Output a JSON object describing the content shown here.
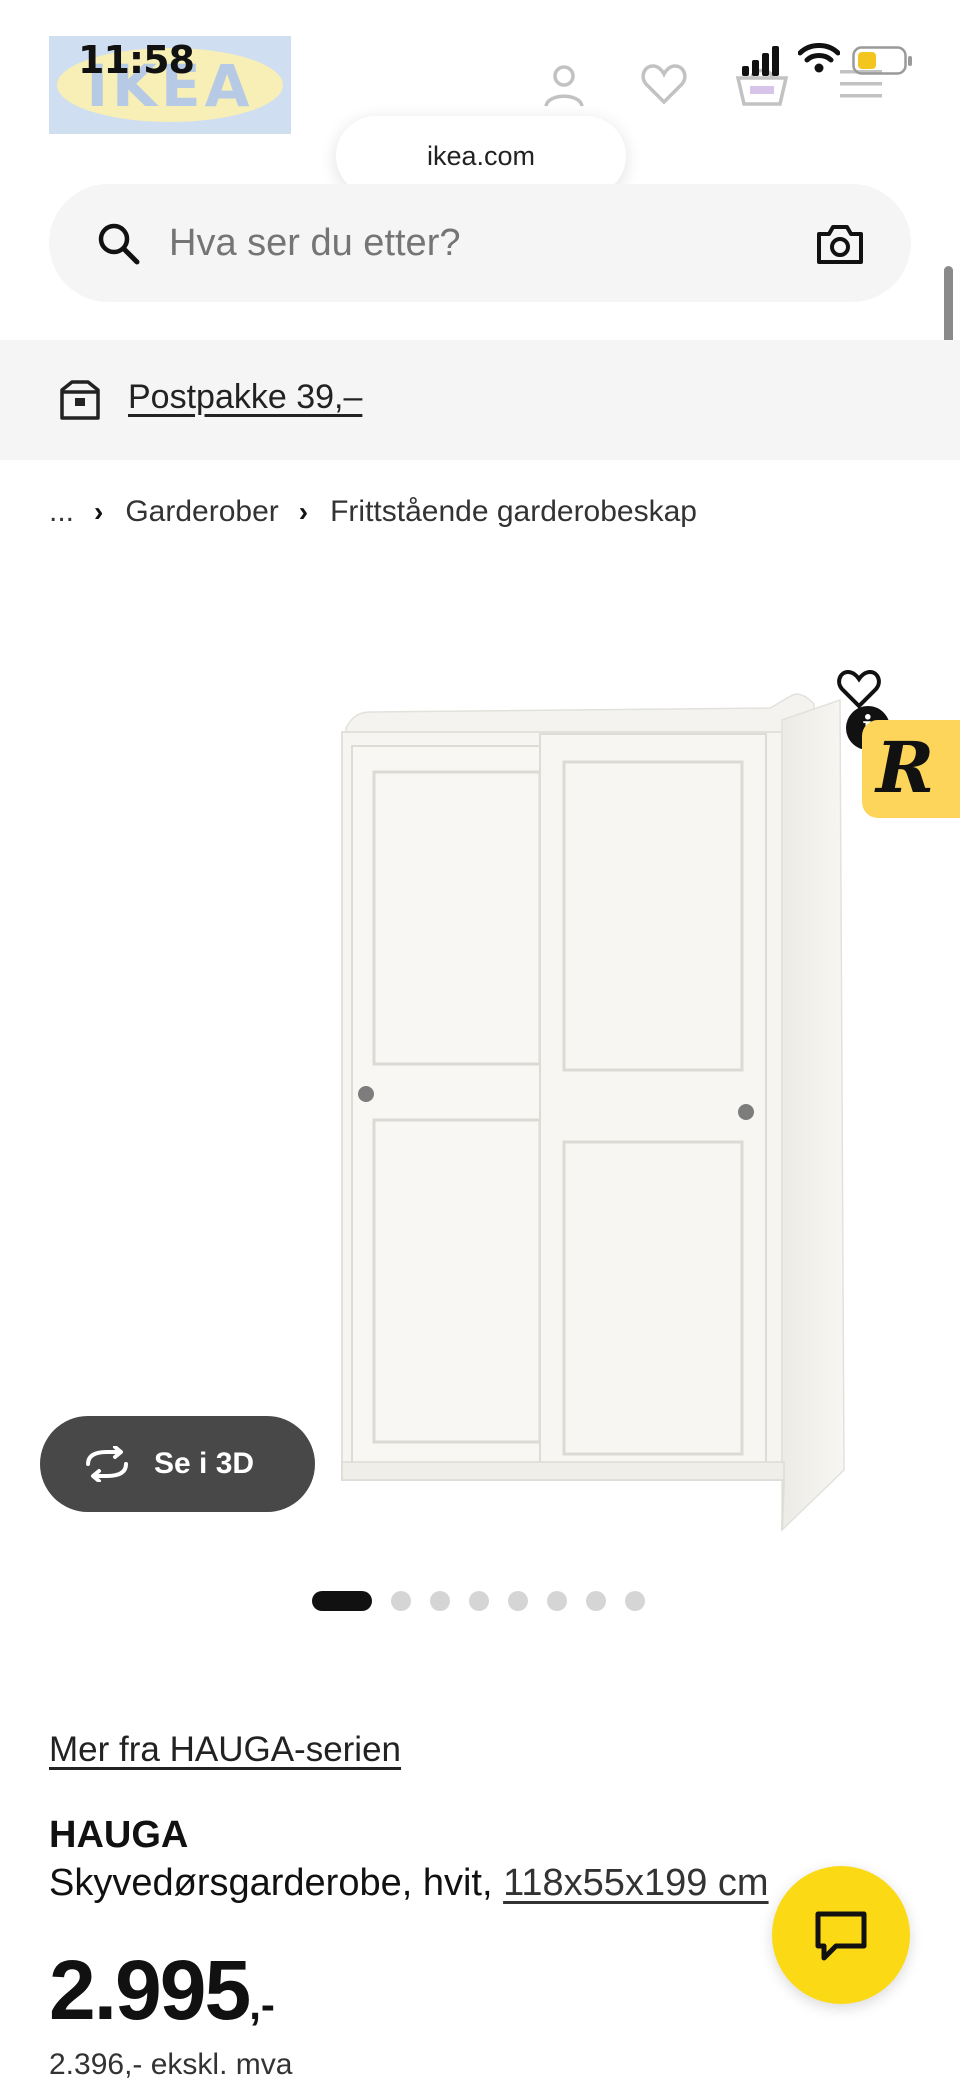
{
  "status_bar": {
    "time": "11:58"
  },
  "header": {
    "logo_text": "IKEA",
    "url": "ikea.com"
  },
  "search": {
    "placeholder": "Hva ser du etter?"
  },
  "delivery": {
    "label": "Postpakke 39,–"
  },
  "breadcrumb": {
    "ellipsis": "...",
    "items": [
      "Garderober",
      "Frittstående garderobeskap"
    ]
  },
  "gallery": {
    "view_3d_label": "Se i 3D",
    "badge_letter": "R",
    "info_letter": "i",
    "total_images": 8,
    "active_index": 0
  },
  "product": {
    "series_link": "Mer fra HAUGA-serien",
    "name": "HAUGA",
    "description": "Skyvedørsgarderobe, hvit, ",
    "size": "118x55x199 cm",
    "price_main": "2.995",
    "price_suffix": ",-",
    "price_ex_vat": "2.396,- ekskl. mva"
  },
  "colors": {
    "accent_yellow": "#fbd914",
    "button_dark": "#484848",
    "badge_yellow": "#fcd55a"
  }
}
